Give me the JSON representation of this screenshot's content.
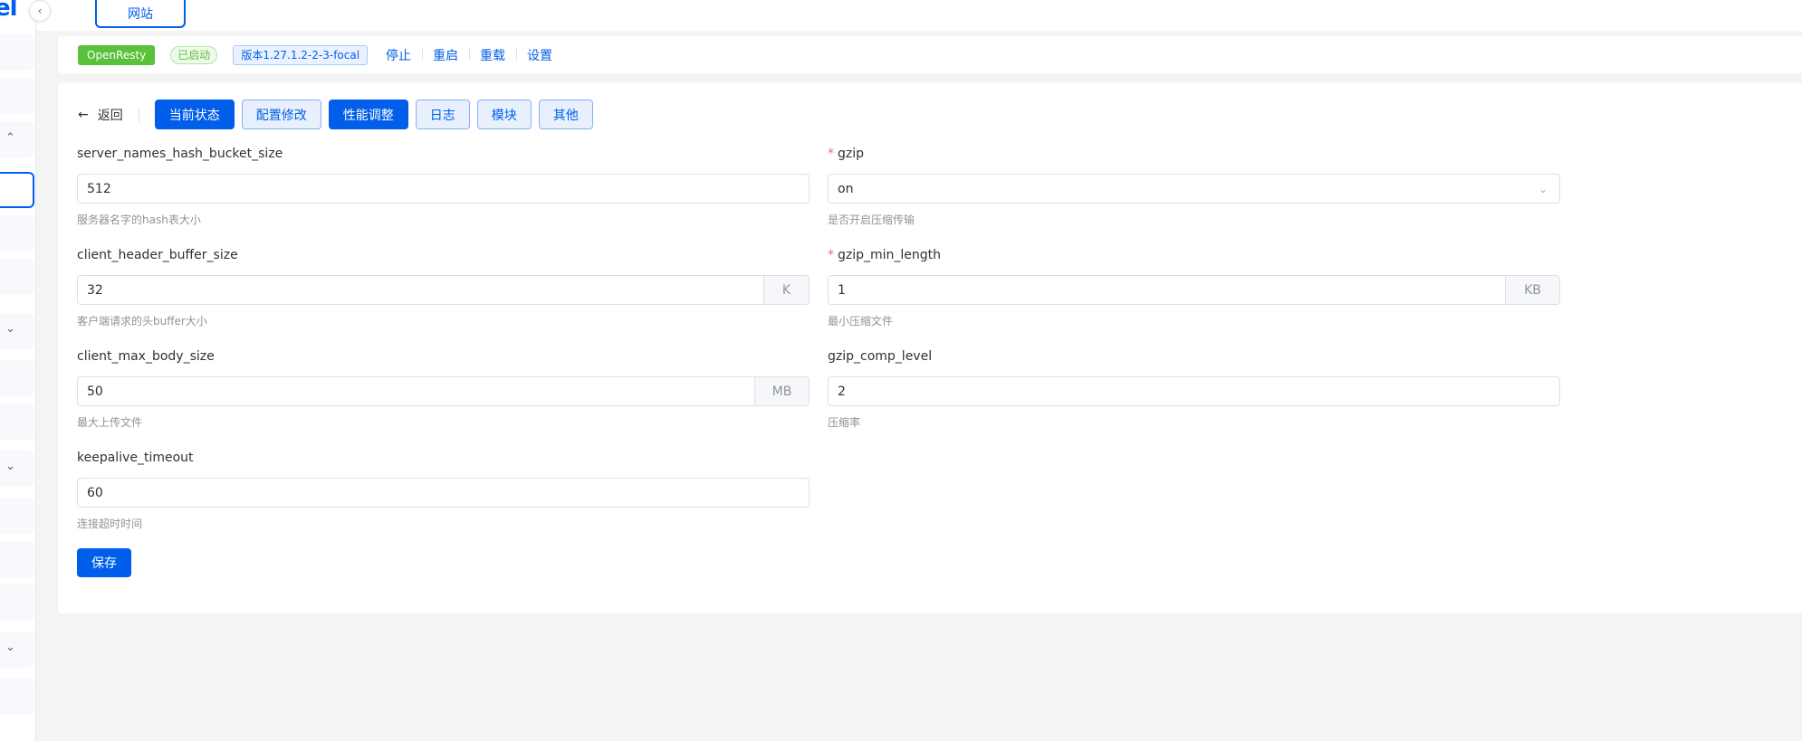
{
  "sidebar": {
    "logo_fragment": "el",
    "collapse_icon": "chevron-left-icon"
  },
  "top_tab": {
    "label": "网站"
  },
  "status": {
    "app_name": "OpenResty",
    "state": "已启动",
    "version": "版本1.27.1.2-2-3-focal",
    "actions": [
      "停止",
      "重启",
      "重载",
      "设置"
    ]
  },
  "nav": {
    "back_label": "返回",
    "tabs": [
      {
        "label": "当前状态",
        "active": true
      },
      {
        "label": "配置修改",
        "active": false
      },
      {
        "label": "性能调整",
        "active": true
      },
      {
        "label": "日志",
        "active": false
      },
      {
        "label": "模块",
        "active": false
      },
      {
        "label": "其他",
        "active": false
      }
    ]
  },
  "form": {
    "server_names_hash_bucket_size": {
      "label": "server_names_hash_bucket_size",
      "value": "512",
      "help": "服务器名字的hash表大小"
    },
    "gzip": {
      "label": "gzip",
      "required": true,
      "value": "on",
      "help": "是否开启压缩传输"
    },
    "client_header_buffer_size": {
      "label": "client_header_buffer_size",
      "value": "32",
      "suffix": "K",
      "help": "客户端请求的头buffer大小"
    },
    "gzip_min_length": {
      "label": "gzip_min_length",
      "required": true,
      "value": "1",
      "suffix": "KB",
      "help": "最小压缩文件"
    },
    "client_max_body_size": {
      "label": "client_max_body_size",
      "value": "50",
      "suffix": "MB",
      "help": "最大上传文件"
    },
    "gzip_comp_level": {
      "label": "gzip_comp_level",
      "value": "2",
      "help": "压缩率"
    },
    "keepalive_timeout": {
      "label": "keepalive_timeout",
      "value": "60",
      "help": "连接超时时间"
    },
    "save_label": "保存"
  },
  "colors": {
    "primary": "#005eeb",
    "success": "#59c13a",
    "required": "#f56c6c"
  }
}
